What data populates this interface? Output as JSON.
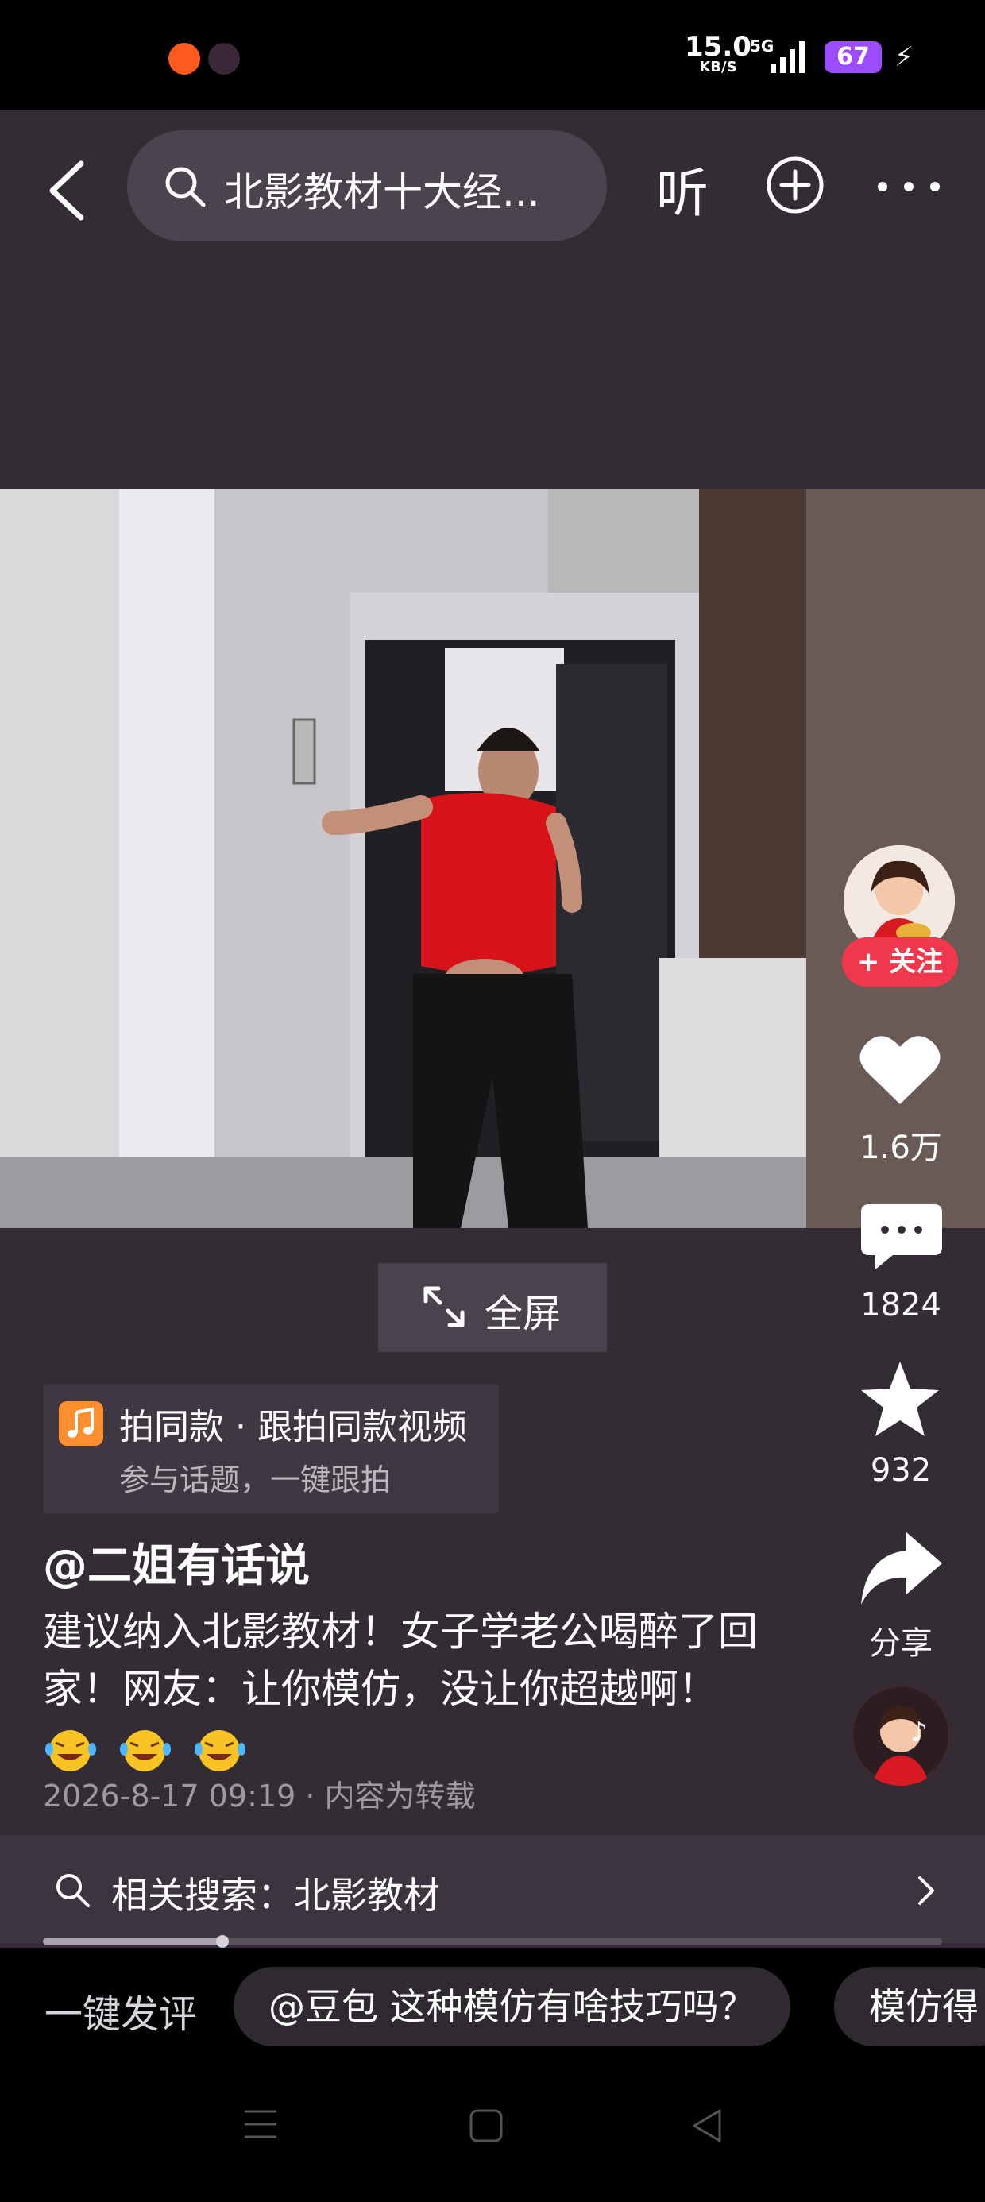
{
  "status_bar": {
    "speed_value": "15.0",
    "speed_unit": "KB/S",
    "network": "5G",
    "battery": "67"
  },
  "header": {
    "search_text": "北影教材十大经...",
    "listen_label": "听"
  },
  "video": {
    "fullscreen_label": "全屏"
  },
  "rail": {
    "follow_label": "+ 关注",
    "likes": "1.6万",
    "comments": "1824",
    "favorites": "932",
    "share_label": "分享"
  },
  "music_card": {
    "title": "拍同款 · 跟拍同款视频",
    "subtitle": "参与话题，一键跟拍"
  },
  "post": {
    "author": "@二姐有话说",
    "description": "建议纳入北影教材！女子学老公喝醉了回家！网友：让你模仿，没让你超越啊！",
    "emoji_names": [
      "rofl-emoji",
      "rofl-emoji",
      "rofl-emoji"
    ],
    "meta": "2026-8-17 09:19 · 内容为转载"
  },
  "related_search": {
    "label": "相关搜索：北影教材",
    "progress": 0.2
  },
  "comment_bar": {
    "label": "一键发评",
    "chips": [
      "@豆包 这种模仿有啥技巧吗？",
      "模仿得"
    ]
  },
  "colors": {
    "background": "#332c35",
    "follow_red": "#f0384d",
    "battery_purple": "#9d4dff",
    "music_orange": "#ff8f2e"
  }
}
